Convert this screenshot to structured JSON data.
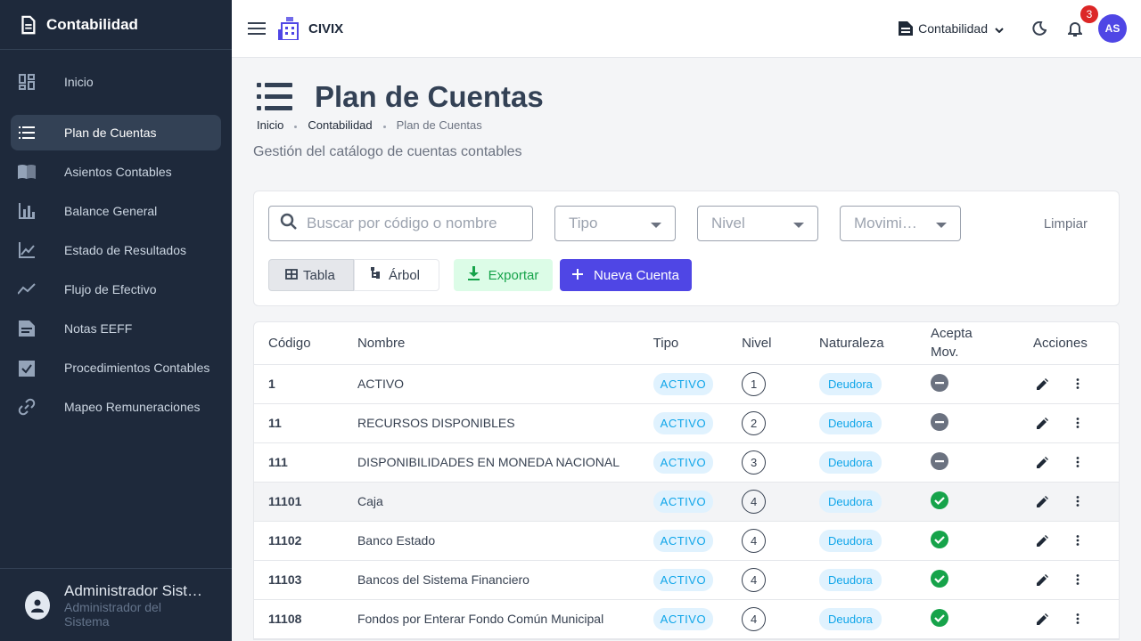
{
  "sidebar": {
    "title": "Contabilidad",
    "items": [
      {
        "label": "Inicio",
        "icon": "dashboard-icon"
      },
      {
        "label": "Plan de Cuentas",
        "icon": "list-icon",
        "active": true
      },
      {
        "label": "Asientos Contables",
        "icon": "book-icon"
      },
      {
        "label": "Balance General",
        "icon": "bar-chart-icon"
      },
      {
        "label": "Estado de Resultados",
        "icon": "line-chart-icon"
      },
      {
        "label": "Flujo de Efectivo",
        "icon": "trend-icon"
      },
      {
        "label": "Notas EEFF",
        "icon": "notes-icon"
      },
      {
        "label": "Procedimientos Contables",
        "icon": "checklist-icon"
      },
      {
        "label": "Mapeo Remuneraciones",
        "icon": "link-icon"
      }
    ],
    "user": {
      "name": "Administrador Sistema",
      "role": "Administrador del Sistema"
    }
  },
  "topbar": {
    "brand": "CIVIX",
    "module": "Contabilidad",
    "notifications": "3",
    "avatar_initials": "AS"
  },
  "page": {
    "title": "Plan de Cuentas",
    "breadcrumb": [
      "Inicio",
      "Contabilidad",
      "Plan de Cuentas"
    ],
    "subtitle": "Gestión del catálogo de cuentas contables"
  },
  "filters": {
    "search_placeholder": "Buscar por código o nombre",
    "tipo": "Tipo",
    "nivel": "Nivel",
    "movimiento": "Movimiento",
    "clear": "Limpiar",
    "view_table": "Tabla",
    "view_tree": "Árbol",
    "export": "Exportar",
    "new_account": "Nueva Cuenta"
  },
  "table": {
    "headers": [
      "Código",
      "Nombre",
      "Tipo",
      "Nivel",
      "Naturaleza",
      "Acepta Mov.",
      "Acciones"
    ],
    "rows": [
      {
        "code": "1",
        "name": "ACTIVO",
        "tipo": "ACTIVO",
        "nivel": "1",
        "naturaleza": "Deudora",
        "acepta": false
      },
      {
        "code": "11",
        "name": "RECURSOS DISPONIBLES",
        "tipo": "ACTIVO",
        "nivel": "2",
        "naturaleza": "Deudora",
        "acepta": false
      },
      {
        "code": "111",
        "name": "DISPONIBILIDADES EN MONEDA NACIONAL",
        "tipo": "ACTIVO",
        "nivel": "3",
        "naturaleza": "Deudora",
        "acepta": false
      },
      {
        "code": "11101",
        "name": "Caja",
        "tipo": "ACTIVO",
        "nivel": "4",
        "naturaleza": "Deudora",
        "acepta": true
      },
      {
        "code": "11102",
        "name": "Banco Estado",
        "tipo": "ACTIVO",
        "nivel": "4",
        "naturaleza": "Deudora",
        "acepta": true
      },
      {
        "code": "11103",
        "name": "Bancos del Sistema Financiero",
        "tipo": "ACTIVO",
        "nivel": "4",
        "naturaleza": "Deudora",
        "acepta": true
      },
      {
        "code": "11108",
        "name": "Fondos por Enterar Fondo Común Municipal",
        "tipo": "ACTIVO",
        "nivel": "4",
        "naturaleza": "Deudora",
        "acepta": true
      }
    ]
  },
  "colors": {
    "sidebar": "#1e293b",
    "accent": "#4f46e5",
    "success": "#16a34a",
    "badge": "#dc2626"
  }
}
